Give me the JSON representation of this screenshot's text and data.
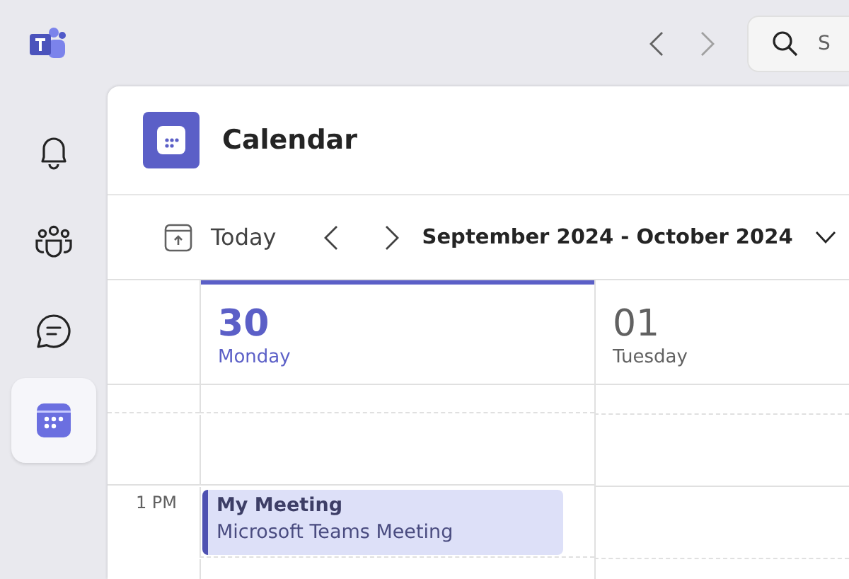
{
  "search": {
    "placeholder": "S"
  },
  "rail": [
    {
      "kind": "bell",
      "selected": false
    },
    {
      "kind": "people",
      "selected": false
    },
    {
      "kind": "chat",
      "selected": false
    },
    {
      "kind": "calendar",
      "selected": true
    }
  ],
  "header": {
    "title": "Calendar"
  },
  "toolbar": {
    "today": "Today",
    "range": "September 2024 - October 2024"
  },
  "days": [
    {
      "number": "30",
      "weekday": "Monday",
      "selected": true
    },
    {
      "number": "01",
      "weekday": "Tuesday",
      "selected": false
    }
  ],
  "hours": [
    {
      "label": "1 PM",
      "cells": [
        {
          "event": {
            "title": "My Meeting",
            "subtitle": "Microsoft Teams Meeting"
          }
        },
        {}
      ]
    }
  ]
}
